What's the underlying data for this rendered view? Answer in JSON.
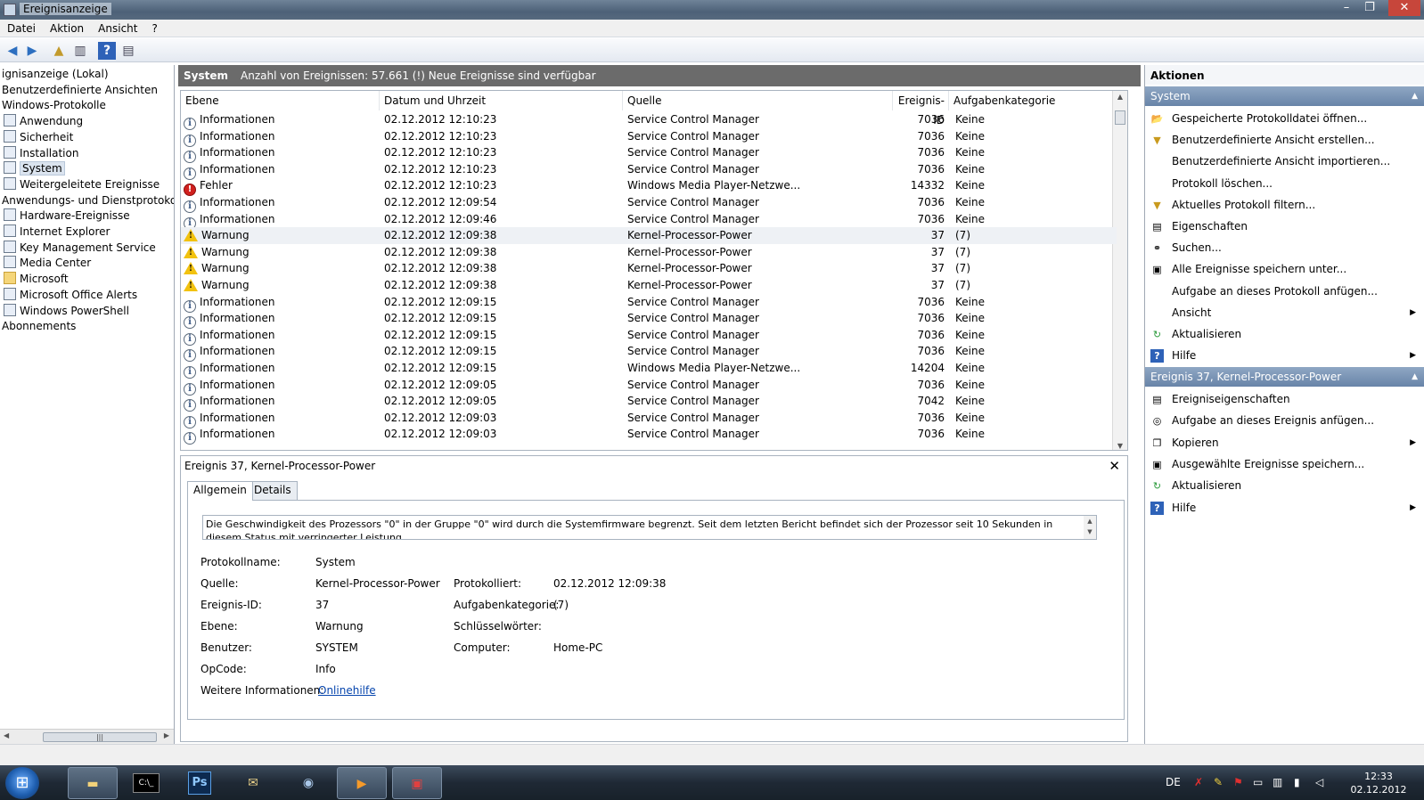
{
  "window": {
    "title": "Ereignisanzeige"
  },
  "menu": [
    "Datei",
    "Aktion",
    "Ansicht",
    "?"
  ],
  "tree": [
    {
      "label": "ignisanzeige (Lokal)",
      "indent": 0,
      "icon": ""
    },
    {
      "label": "Benutzerdefinierte Ansichten",
      "indent": 0,
      "icon": ""
    },
    {
      "label": "Windows-Protokolle",
      "indent": 0,
      "icon": ""
    },
    {
      "label": "Anwendung",
      "indent": 1,
      "icon": "log"
    },
    {
      "label": "Sicherheit",
      "indent": 1,
      "icon": "log"
    },
    {
      "label": "Installation",
      "indent": 1,
      "icon": "log"
    },
    {
      "label": "System",
      "indent": 1,
      "icon": "log",
      "selected": true
    },
    {
      "label": "Weitergeleitete Ereignisse",
      "indent": 1,
      "icon": "log"
    },
    {
      "label": "Anwendungs- und Dienstprotokolle",
      "indent": 0,
      "icon": ""
    },
    {
      "label": "Hardware-Ereignisse",
      "indent": 1,
      "icon": "log"
    },
    {
      "label": "Internet Explorer",
      "indent": 1,
      "icon": "log"
    },
    {
      "label": "Key Management Service",
      "indent": 1,
      "icon": "log"
    },
    {
      "label": "Media Center",
      "indent": 1,
      "icon": "log"
    },
    {
      "label": "Microsoft",
      "indent": 1,
      "icon": "folder"
    },
    {
      "label": "Microsoft Office Alerts",
      "indent": 1,
      "icon": "log"
    },
    {
      "label": "Windows PowerShell",
      "indent": 1,
      "icon": "log"
    },
    {
      "label": "Abonnements",
      "indent": 0,
      "icon": ""
    }
  ],
  "center_header": {
    "title": "System",
    "info": "Anzahl von Ereignissen: 57.661 (!) Neue Ereignisse sind verfügbar"
  },
  "columns": [
    "Ebene",
    "Datum und Uhrzeit",
    "Quelle",
    "Ereignis-ID",
    "Aufgabenkategorie"
  ],
  "events": [
    {
      "level": "Informationen",
      "type": "info",
      "date": "02.12.2012 12:10:23",
      "source": "Service Control Manager",
      "id": "7036",
      "category": "Keine"
    },
    {
      "level": "Informationen",
      "type": "info",
      "date": "02.12.2012 12:10:23",
      "source": "Service Control Manager",
      "id": "7036",
      "category": "Keine"
    },
    {
      "level": "Informationen",
      "type": "info",
      "date": "02.12.2012 12:10:23",
      "source": "Service Control Manager",
      "id": "7036",
      "category": "Keine"
    },
    {
      "level": "Informationen",
      "type": "info",
      "date": "02.12.2012 12:10:23",
      "source": "Service Control Manager",
      "id": "7036",
      "category": "Keine"
    },
    {
      "level": "Fehler",
      "type": "error",
      "date": "02.12.2012 12:10:23",
      "source": "Windows Media Player-Netzwe...",
      "id": "14332",
      "category": "Keine"
    },
    {
      "level": "Informationen",
      "type": "info",
      "date": "02.12.2012 12:09:54",
      "source": "Service Control Manager",
      "id": "7036",
      "category": "Keine"
    },
    {
      "level": "Informationen",
      "type": "info",
      "date": "02.12.2012 12:09:46",
      "source": "Service Control Manager",
      "id": "7036",
      "category": "Keine"
    },
    {
      "level": "Warnung",
      "type": "warn",
      "date": "02.12.2012 12:09:38",
      "source": "Kernel-Processor-Power",
      "id": "37",
      "category": "(7)",
      "highlight": true
    },
    {
      "level": "Warnung",
      "type": "warn",
      "date": "02.12.2012 12:09:38",
      "source": "Kernel-Processor-Power",
      "id": "37",
      "category": "(7)"
    },
    {
      "level": "Warnung",
      "type": "warn",
      "date": "02.12.2012 12:09:38",
      "source": "Kernel-Processor-Power",
      "id": "37",
      "category": "(7)"
    },
    {
      "level": "Warnung",
      "type": "warn",
      "date": "02.12.2012 12:09:38",
      "source": "Kernel-Processor-Power",
      "id": "37",
      "category": "(7)"
    },
    {
      "level": "Informationen",
      "type": "info",
      "date": "02.12.2012 12:09:15",
      "source": "Service Control Manager",
      "id": "7036",
      "category": "Keine"
    },
    {
      "level": "Informationen",
      "type": "info",
      "date": "02.12.2012 12:09:15",
      "source": "Service Control Manager",
      "id": "7036",
      "category": "Keine"
    },
    {
      "level": "Informationen",
      "type": "info",
      "date": "02.12.2012 12:09:15",
      "source": "Service Control Manager",
      "id": "7036",
      "category": "Keine"
    },
    {
      "level": "Informationen",
      "type": "info",
      "date": "02.12.2012 12:09:15",
      "source": "Service Control Manager",
      "id": "7036",
      "category": "Keine"
    },
    {
      "level": "Informationen",
      "type": "info",
      "date": "02.12.2012 12:09:15",
      "source": "Windows Media Player-Netzwe...",
      "id": "14204",
      "category": "Keine"
    },
    {
      "level": "Informationen",
      "type": "info",
      "date": "02.12.2012 12:09:05",
      "source": "Service Control Manager",
      "id": "7036",
      "category": "Keine"
    },
    {
      "level": "Informationen",
      "type": "info",
      "date": "02.12.2012 12:09:05",
      "source": "Service Control Manager",
      "id": "7042",
      "category": "Keine"
    },
    {
      "level": "Informationen",
      "type": "info",
      "date": "02.12.2012 12:09:03",
      "source": "Service Control Manager",
      "id": "7036",
      "category": "Keine"
    },
    {
      "level": "Informationen",
      "type": "info",
      "date": "02.12.2012 12:09:03",
      "source": "Service Control Manager",
      "id": "7036",
      "category": "Keine"
    }
  ],
  "detail": {
    "title": "Ereignis 37, Kernel-Processor-Power",
    "tabs": [
      "Allgemein",
      "Details"
    ],
    "description": "Die Geschwindigkeit des Prozessors \"0\" in der Gruppe \"0\" wird durch die Systemfirmware begrenzt. Seit dem letzten Bericht befindet sich der Prozessor seit 10 Sekunden in diesem Status mit verringerter Leistung.",
    "labels": {
      "logname": "Protokollname:",
      "source": "Quelle:",
      "eventid": "Ereignis-ID:",
      "level": "Ebene:",
      "user": "Benutzer:",
      "opcode": "OpCode:",
      "moreinfo": "Weitere Informationen:",
      "logged": "Protokolliert:",
      "taskcat": "Aufgabenkategorie:",
      "keywords": "Schlüsselwörter:",
      "computer": "Computer:"
    },
    "values": {
      "logname": "System",
      "source": "Kernel-Processor-Power",
      "eventid": "37",
      "level": "Warnung",
      "user": "SYSTEM",
      "opcode": "Info",
      "moreinfo": "Onlinehilfe",
      "logged": "02.12.2012 12:09:38",
      "taskcat": "(7)",
      "keywords": "",
      "computer": "Home-PC"
    }
  },
  "actions": {
    "header": "Aktionen",
    "section1": "System",
    "items1": [
      {
        "label": "Gespeicherte Protokolldatei öffnen...",
        "icon": "folder-open-icon",
        "glyph": "📂"
      },
      {
        "label": "Benutzerdefinierte Ansicht erstellen...",
        "icon": "filter-icon",
        "glyph": "▼"
      },
      {
        "label": "Benutzerdefinierte Ansicht importieren...",
        "icon": "",
        "glyph": ""
      },
      {
        "label": "Protokoll löschen...",
        "icon": "",
        "glyph": ""
      },
      {
        "label": "Aktuelles Protokoll filtern...",
        "icon": "filter-icon",
        "glyph": "▼"
      },
      {
        "label": "Eigenschaften",
        "icon": "properties-icon",
        "glyph": "▤"
      },
      {
        "label": "Suchen...",
        "icon": "binoculars-icon",
        "glyph": "⚭"
      },
      {
        "label": "Alle Ereignisse speichern unter...",
        "icon": "save-icon",
        "glyph": "▣"
      },
      {
        "label": "Aufgabe an dieses Protokoll anfügen...",
        "icon": "",
        "glyph": ""
      },
      {
        "label": "Ansicht",
        "icon": "",
        "glyph": "",
        "submenu": true
      },
      {
        "label": "Aktualisieren",
        "icon": "refresh-icon",
        "glyph": "↻"
      },
      {
        "label": "Hilfe",
        "icon": "help-icon",
        "glyph": "?",
        "submenu": true
      }
    ],
    "section2": "Ereignis 37, Kernel-Processor-Power",
    "items2": [
      {
        "label": "Ereigniseigenschaften",
        "icon": "properties-icon",
        "glyph": "▤"
      },
      {
        "label": "Aufgabe an dieses Ereignis anfügen...",
        "icon": "task-icon",
        "glyph": "◎"
      },
      {
        "label": "Kopieren",
        "icon": "copy-icon",
        "glyph": "❐",
        "submenu": true
      },
      {
        "label": "Ausgewählte Ereignisse speichern...",
        "icon": "save-icon",
        "glyph": "▣"
      },
      {
        "label": "Aktualisieren",
        "icon": "refresh-icon",
        "glyph": "↻"
      },
      {
        "label": "Hilfe",
        "icon": "help-icon",
        "glyph": "?",
        "submenu": true
      }
    ]
  },
  "taskbar": {
    "lang": "DE",
    "time": "12:33",
    "date": "02.12.2012",
    "ps_label": "Ps"
  },
  "colors": {
    "selection": "#dbe4ef",
    "header": "#6b6b6b",
    "section": "#7894b6",
    "link": "#0645ad"
  }
}
